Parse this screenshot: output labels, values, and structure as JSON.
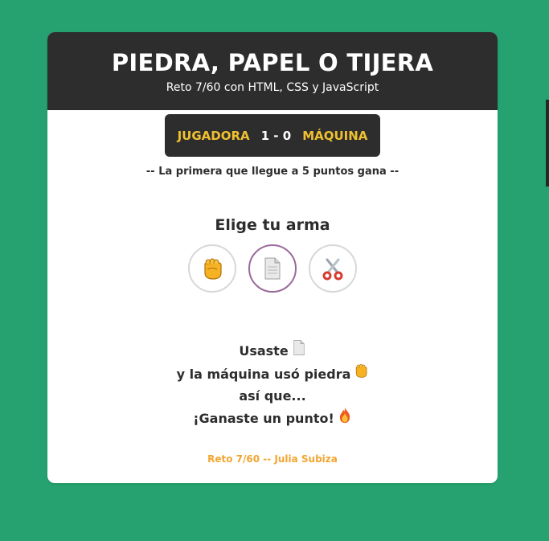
{
  "header": {
    "title": "PIEDRA, PAPEL O TIJERA",
    "subtitle": "Reto 7/60 con HTML, CSS y JavaScript"
  },
  "scoreboard": {
    "player_label": "JUGADORA",
    "score": "1 - 0",
    "machine_label": "MÁQUINA"
  },
  "rule": "-- La primera que llegue a 5 puntos gana --",
  "prompt": "Elige tu arma",
  "options": [
    {
      "icon": "fist-icon",
      "label": "rock"
    },
    {
      "icon": "paper-icon",
      "label": "paper",
      "selected": true
    },
    {
      "icon": "scissors-icon",
      "label": "scissors"
    }
  ],
  "result": {
    "line1": "Usaste",
    "line2": "y la máquina usó piedra",
    "line3": "así que...",
    "line4": "¡Ganaste un punto!"
  },
  "footer": "Reto 7/60 -- Julia Subiza",
  "colors": {
    "background": "#26a270",
    "dark": "#2d2d2d",
    "accent": "#f0c030",
    "footer": "#f3a530"
  }
}
